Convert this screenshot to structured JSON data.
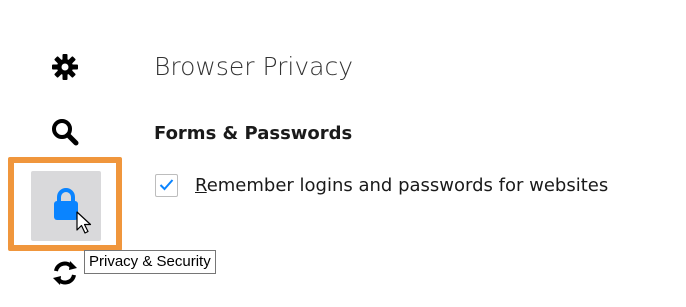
{
  "sidebar": {
    "items": [
      {
        "icon": "gear-icon"
      },
      {
        "icon": "search-icon"
      },
      {
        "icon": "lock-icon",
        "selected": true,
        "highlight_color": "#f0963c"
      },
      {
        "icon": "sync-icon"
      }
    ],
    "tooltip": "Privacy & Security"
  },
  "main": {
    "title": "Browser Privacy",
    "section_heading": "Forms & Passwords",
    "remember_logins": {
      "checked": true,
      "label_accesskey": "R",
      "label_rest": "emember logins and passwords for websites"
    }
  },
  "colors": {
    "accent": "#0a84ff",
    "highlight": "#f0963c"
  }
}
